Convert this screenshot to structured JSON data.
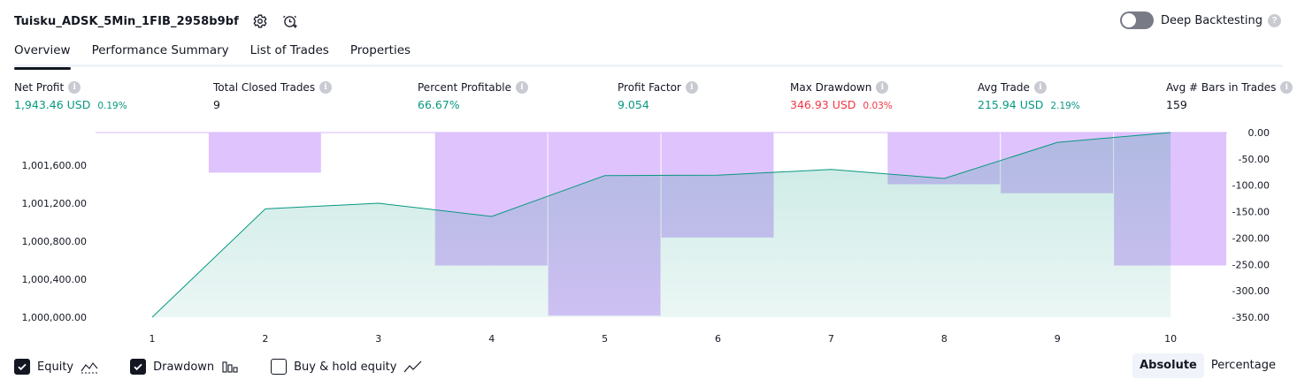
{
  "header": {
    "strategy_name": "Tuisku_ADSK_5Min_1FIB_2958b9bf",
    "settings_icon": "gear-icon",
    "alert_icon": "alarm-clock-add-icon"
  },
  "deep_backtesting": {
    "label": "Deep Backtesting",
    "enabled": false,
    "help": "?"
  },
  "tabs": [
    {
      "label": "Overview",
      "active": true
    },
    {
      "label": "Performance Summary",
      "active": false
    },
    {
      "label": "List of Trades",
      "active": false
    },
    {
      "label": "Properties",
      "active": false
    }
  ],
  "metrics": {
    "net_profit": {
      "label": "Net Profit",
      "value": "1,943.46 USD",
      "sub": "0.19%",
      "tone": "pos"
    },
    "total_closed_trades": {
      "label": "Total Closed Trades",
      "value": "9",
      "sub": "",
      "tone": "neu"
    },
    "percent_profitable": {
      "label": "Percent Profitable",
      "value": "66.67%",
      "sub": "",
      "tone": "pos"
    },
    "profit_factor": {
      "label": "Profit Factor",
      "value": "9.054",
      "sub": "",
      "tone": "pos"
    },
    "max_drawdown": {
      "label": "Max Drawdown",
      "value": "346.93 USD",
      "sub": "0.03%",
      "tone": "neg"
    },
    "avg_trade": {
      "label": "Avg Trade",
      "value": "215.94 USD",
      "sub": "2.19%",
      "tone": "pos"
    },
    "avg_bars": {
      "label": "Avg # Bars in Trades",
      "value": "159",
      "sub": "",
      "tone": "neu"
    }
  },
  "chart_data": {
    "type": "bar",
    "x": [
      "1",
      "2",
      "3",
      "4",
      "5",
      "6",
      "7",
      "8",
      "9",
      "10"
    ],
    "left_axis": {
      "ticks": [
        "1,001,600.00",
        "1,001,200.00",
        "1,000,800.00",
        "1,000,400.00",
        "1,000,000.00"
      ],
      "tick_values": [
        1001600,
        1001200,
        1000800,
        1000400,
        1000000
      ],
      "ylim": [
        1000000,
        1001943.46
      ]
    },
    "right_axis": {
      "ticks": [
        "0.00",
        "-50.00",
        "-100.00",
        "-150.00",
        "-200.00",
        "-250.00",
        "-300.00",
        "-350.00"
      ],
      "tick_values": [
        0,
        -50,
        -100,
        -150,
        -200,
        -250,
        -300,
        -350
      ],
      "ylim": [
        -350,
        0
      ]
    },
    "series": [
      {
        "name": "Equity",
        "type": "area",
        "axis": "left",
        "color": "#089981",
        "values": [
          1000000,
          1001140,
          1001200,
          1001060,
          1001490,
          1001495,
          1001555,
          1001460,
          1001840,
          1001943.46
        ]
      },
      {
        "name": "Drawdown",
        "type": "bar",
        "axis": "right",
        "color": "#d9b8fb",
        "values": [
          0,
          -76,
          0,
          -252,
          -347,
          -199,
          0,
          -98,
          -115,
          -252
        ]
      }
    ],
    "grid": false
  },
  "legend": {
    "equity": {
      "label": "Equity",
      "checked": true,
      "icon": "equity-area-icon"
    },
    "drawdown": {
      "label": "Drawdown",
      "checked": true,
      "icon": "drawdown-bars-icon"
    },
    "buy_hold": {
      "label": "Buy & hold equity",
      "checked": false,
      "icon": "buy-hold-line-icon"
    }
  },
  "view_mode": {
    "absolute": "Absolute",
    "percentage": "Percentage",
    "selected": "absolute"
  },
  "colors": {
    "positive": "#089981",
    "negative": "#f23645",
    "equity_line": "#089981",
    "drawdown_fill": "#d9b8fb"
  }
}
